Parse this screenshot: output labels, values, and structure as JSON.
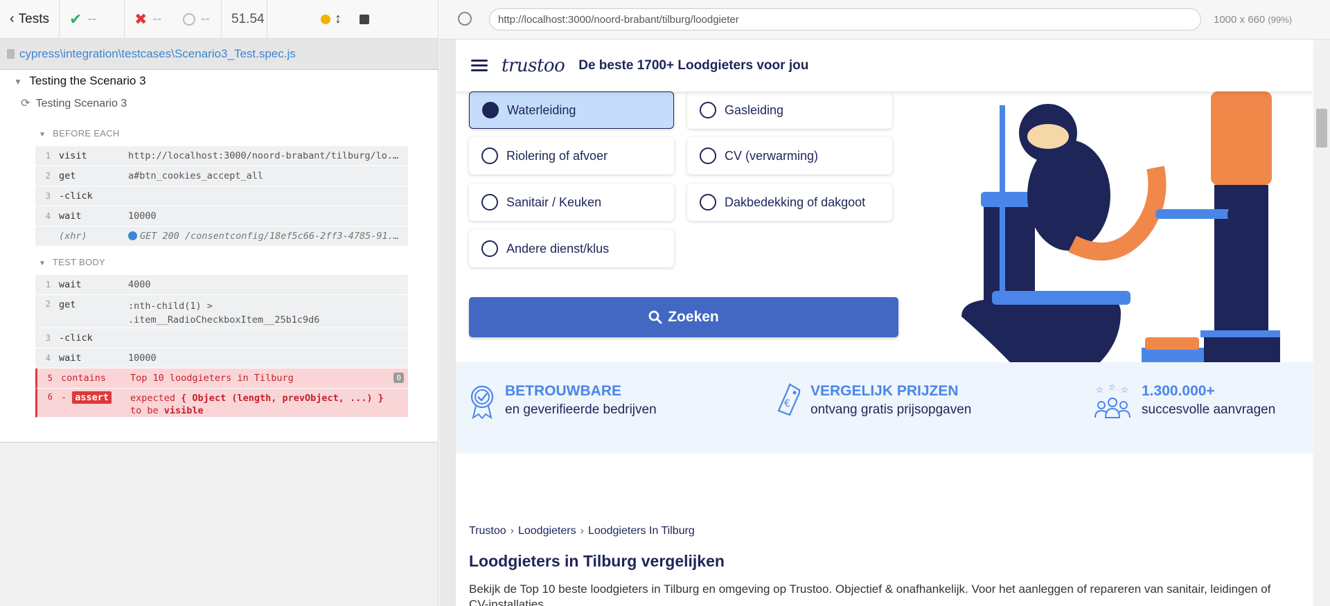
{
  "runner": {
    "back_label": "Tests",
    "passed": "--",
    "failed": "--",
    "pending": "--",
    "duration": "51.54",
    "spec_path": "cypress\\integration\\testcases\\Scenario3_Test.spec.js",
    "suite": "Testing the Scenario 3",
    "test": "Testing Scenario 3",
    "before_each": {
      "label": "BEFORE EACH",
      "commands": [
        {
          "n": "1",
          "name": "visit",
          "arg": "http://localhost:3000/noord-brabant/tilburg/lo..."
        },
        {
          "n": "2",
          "name": "get",
          "arg": "a#btn_cookies_accept_all"
        },
        {
          "n": "3",
          "name": "-click",
          "arg": ""
        },
        {
          "n": "4",
          "name": "wait",
          "arg": "10000"
        },
        {
          "n": "",
          "name": "(xhr)",
          "arg": "GET 200 /consentconfig/18ef5c66-2ff3-4785-91..."
        }
      ]
    },
    "test_body": {
      "label": "TEST BODY",
      "commands": [
        {
          "n": "1",
          "name": "wait",
          "arg": "4000"
        },
        {
          "n": "2",
          "name": "get",
          "arg": ":nth-child(1) >",
          "arg2": ".item__RadioCheckboxItem__25b1c9d6"
        },
        {
          "n": "3",
          "name": "-click",
          "arg": ""
        },
        {
          "n": "4",
          "name": "wait",
          "arg": "10000"
        },
        {
          "n": "5",
          "name": "contains",
          "arg": "Top 10 loodgieters in Tilburg",
          "badge": "0"
        },
        {
          "n": "6",
          "name": "assert",
          "arg_a": "expected",
          "arg_b": "{ Object (length, prevObject, ...) }",
          "arg_c": "to be",
          "arg_d": "visible"
        }
      ]
    }
  },
  "aut": {
    "url": "http://localhost:3000/noord-brabant/tilburg/loodgieter",
    "viewport": "1000 x 660",
    "zoom": "(99%)",
    "tagline": "De beste 1700+ Loodgieters voor jou",
    "logo": "trustoo",
    "options": [
      {
        "label": "Waterleiding",
        "selected": true
      },
      {
        "label": "Gasleiding",
        "selected": false
      },
      {
        "label": "Riolering of afvoer",
        "selected": false
      },
      {
        "label": "CV (verwarming)",
        "selected": false
      },
      {
        "label": "Sanitair / Keuken",
        "selected": false
      },
      {
        "label": "Dakbedekking of dakgoot",
        "selected": false
      },
      {
        "label": "Andere dienst/klus",
        "selected": false
      }
    ],
    "search_label": "Zoeken",
    "features": [
      {
        "title": "BETROUWBARE",
        "sub": "en geverifieerde bedrijven"
      },
      {
        "title": "VERGELIJK PRIJZEN",
        "sub": "ontvang gratis prijsopgaven"
      },
      {
        "title": "1.300.000+",
        "sub": "succesvolle aanvragen"
      }
    ],
    "breadcrumb": [
      "Trustoo",
      "Loodgieters",
      "Loodgieters In Tilburg"
    ],
    "page_title": "Loodgieters in Tilburg vergelijken",
    "page_desc": "Bekijk de Top 10 beste loodgieters in Tilburg en omgeving op Trustoo. Objectief & onafhankelijk. Voor het aanleggen of repareren van sanitair, leidingen of CV-installaties."
  },
  "colors": {
    "navy": "#1e2559",
    "accent_blue": "#4a86e8",
    "button": "#4268c4",
    "error": "#e03838"
  }
}
